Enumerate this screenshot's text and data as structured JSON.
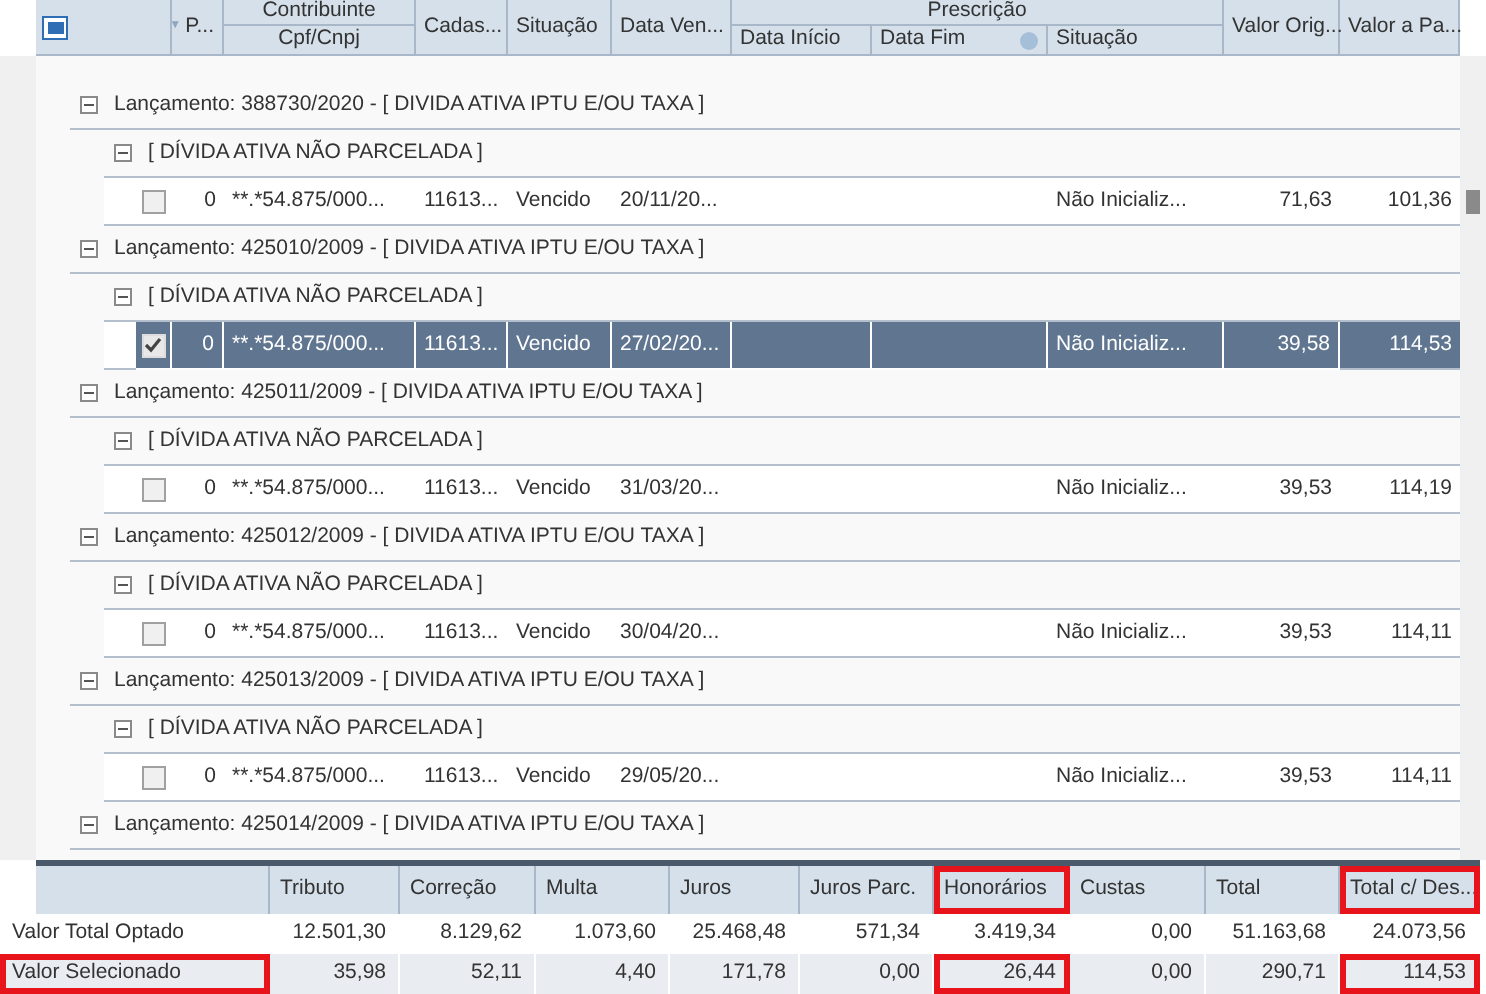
{
  "header": {
    "select_all": {
      "indeterminate": true
    },
    "group_headers": [
      {
        "label": "Contribuinte"
      },
      {
        "label": "Prescrição"
      }
    ],
    "columns": [
      {
        "label": "P...",
        "sort_icon": "▼"
      },
      {
        "label": "Cpf/Cnpj"
      },
      {
        "label": "Cadas..."
      },
      {
        "label": "Situação"
      },
      {
        "label": "Data Ven..."
      },
      {
        "label": "Data Início"
      },
      {
        "label": "Data Fim",
        "help": true
      },
      {
        "label": "Situação"
      },
      {
        "label": "Valor Orig..."
      },
      {
        "label": "Valor a Pa..."
      }
    ]
  },
  "lancamentos": [
    {
      "label": "Lançamento: 388730/2020 - [ DIVIDA ATIVA IPTU E/OU TAXA ]",
      "expanded": true,
      "children": [
        {
          "label": "[ DÍVIDA ATIVA NÃO PARCELADA ]",
          "expanded": true,
          "children": [
            {
              "checked": false,
              "selected": false,
              "cells": [
                "0",
                "**.*54.875/000...",
                "11613...",
                "Vencido",
                "20/11/20...",
                null,
                null,
                "Não Inicializ...",
                "71,63",
                "101,36"
              ]
            }
          ]
        }
      ]
    },
    {
      "label": "Lançamento: 425010/2009 - [ DIVIDA ATIVA IPTU E/OU TAXA ]",
      "expanded": true,
      "children": [
        {
          "label": "[ DÍVIDA ATIVA NÃO PARCELADA ]",
          "expanded": true,
          "children": [
            {
              "checked": true,
              "selected": true,
              "cells": [
                "0",
                "**.*54.875/000...",
                "11613...",
                "Vencido",
                "27/02/20...",
                null,
                null,
                "Não Inicializ...",
                "39,58",
                "114,53"
              ]
            }
          ]
        }
      ]
    },
    {
      "label": "Lançamento: 425011/2009 - [ DIVIDA ATIVA IPTU E/OU TAXA ]",
      "expanded": true,
      "children": [
        {
          "label": "[ DÍVIDA ATIVA NÃO PARCELADA ]",
          "expanded": true,
          "children": [
            {
              "checked": false,
              "selected": false,
              "cells": [
                "0",
                "**.*54.875/000...",
                "11613...",
                "Vencido",
                "31/03/20...",
                null,
                null,
                "Não Inicializ...",
                "39,53",
                "114,19"
              ]
            }
          ]
        }
      ]
    },
    {
      "label": "Lançamento: 425012/2009 - [ DIVIDA ATIVA IPTU E/OU TAXA ]",
      "expanded": true,
      "children": [
        {
          "label": "[ DÍVIDA ATIVA NÃO PARCELADA ]",
          "expanded": true,
          "children": [
            {
              "checked": false,
              "selected": false,
              "cells": [
                "0",
                "**.*54.875/000...",
                "11613...",
                "Vencido",
                "30/04/20...",
                null,
                null,
                "Não Inicializ...",
                "39,53",
                "114,11"
              ]
            }
          ]
        }
      ]
    },
    {
      "label": "Lançamento: 425013/2009 - [ DIVIDA ATIVA IPTU E/OU TAXA ]",
      "expanded": true,
      "children": [
        {
          "label": "[ DÍVIDA ATIVA NÃO PARCELADA ]",
          "expanded": true,
          "children": [
            {
              "checked": false,
              "selected": false,
              "cells": [
                "0",
                "**.*54.875/000...",
                "11613...",
                "Vencido",
                "29/05/20...",
                null,
                null,
                "Não Inicializ...",
                "39,53",
                "114,11"
              ]
            }
          ]
        }
      ]
    },
    {
      "label": "Lançamento: 425014/2009 - [ DIVIDA ATIVA IPTU E/OU TAXA ]",
      "expanded": true
    }
  ],
  "totals": {
    "columns": [
      {
        "label": "Tributo",
        "highlighted": false
      },
      {
        "label": "Correção",
        "highlighted": false
      },
      {
        "label": "Multa",
        "highlighted": false
      },
      {
        "label": "Juros",
        "highlighted": false
      },
      {
        "label": "Juros Parc.",
        "highlighted": false
      },
      {
        "label": "Honorários",
        "highlighted": true
      },
      {
        "label": "Custas",
        "highlighted": false
      },
      {
        "label": "Total",
        "highlighted": false
      },
      {
        "label": "Total c/ Des...",
        "highlighted": true
      }
    ],
    "rows": [
      {
        "label": "Valor Total Optado",
        "highlighted": false,
        "values": [
          {
            "text": "12.501,30",
            "highlighted": false
          },
          {
            "text": "8.129,62",
            "highlighted": false
          },
          {
            "text": "1.073,60",
            "highlighted": false
          },
          {
            "text": "25.468,48",
            "highlighted": false
          },
          {
            "text": "571,34",
            "highlighted": false
          },
          {
            "text": "3.419,34",
            "highlighted": false
          },
          {
            "text": "0,00",
            "highlighted": false
          },
          {
            "text": "51.163,68",
            "highlighted": false
          },
          {
            "text": "24.073,56",
            "highlighted": false
          }
        ]
      },
      {
        "label": "Valor Selecionado",
        "highlighted": true,
        "values": [
          {
            "text": "35,98",
            "highlighted": false
          },
          {
            "text": "52,11",
            "highlighted": false
          },
          {
            "text": "4,40",
            "highlighted": false
          },
          {
            "text": "171,78",
            "highlighted": false
          },
          {
            "text": "0,00",
            "highlighted": false
          },
          {
            "text": "26,44",
            "highlighted": true
          },
          {
            "text": "0,00",
            "highlighted": false
          },
          {
            "text": "290,71",
            "highlighted": false
          },
          {
            "text": "114,53",
            "highlighted": true
          }
        ]
      }
    ]
  }
}
